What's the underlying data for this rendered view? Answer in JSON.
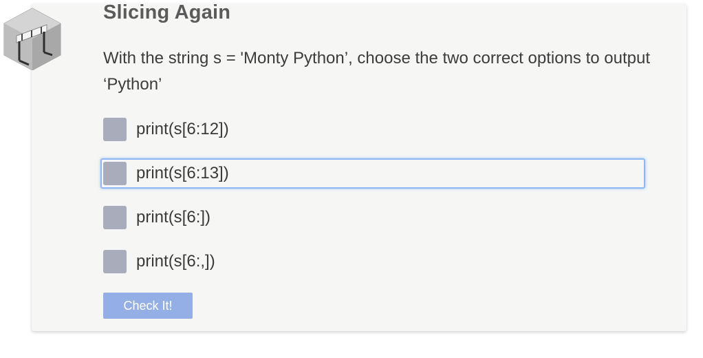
{
  "quiz": {
    "title": "Slicing Again",
    "question": "With the string s = 'Monty Python’, choose the two correct options to output ‘Python’",
    "options": [
      {
        "label": "print(s[6:12])"
      },
      {
        "label": "print(s[6:13])"
      },
      {
        "label": "print(s[6:])"
      },
      {
        "label": "print(s[6:,])"
      }
    ],
    "submit_label": "Check It!"
  },
  "badge_icon": "hurdle-cube-icon",
  "colors": {
    "card_background": "#f6f7f5",
    "checkbox": "#a9adbb",
    "button": "#93afe6",
    "focus_ring": "#8cb7f0"
  }
}
